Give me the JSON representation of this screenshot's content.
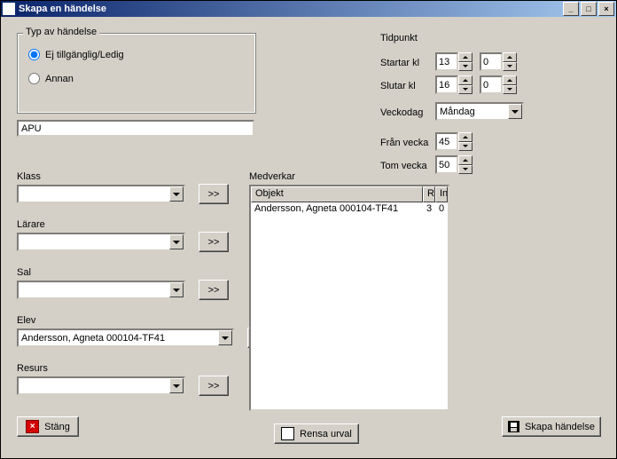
{
  "window": {
    "title": "Skapa en händelse"
  },
  "titlebar_buttons": {
    "min": "_",
    "max": "□",
    "close": "×"
  },
  "group_type": {
    "legend": "Typ av händelse",
    "opt_unavailable": "Ej tillgänglig/Ledig",
    "opt_other": "Annan"
  },
  "subject_value": "APU",
  "left": {
    "klass": {
      "label": "Klass",
      "value": ""
    },
    "larare": {
      "label": "Lärare",
      "value": ""
    },
    "sal": {
      "label": "Sal",
      "value": ""
    },
    "elev": {
      "label": "Elev",
      "value": "Andersson, Agneta 000104-TF41"
    },
    "resurs": {
      "label": "Resurs",
      "value": ""
    },
    "add_btn": ">>"
  },
  "time": {
    "heading": "Tidpunkt",
    "start_label": "Startar kl",
    "end_label": "Slutar kl",
    "weekday_label": "Veckodag",
    "from_week_label": "Från vecka",
    "to_week_label": "Tom vecka",
    "start_h": "13",
    "start_m": "0",
    "end_h": "16",
    "end_m": "0",
    "weekday": "Måndag",
    "from_week": "45",
    "to_week": "50"
  },
  "participants": {
    "heading": "Medverkar",
    "col_object": "Objekt",
    "col_r": "R",
    "col_in": "In",
    "rows": [
      {
        "object": "Andersson, Agneta 000104-TF41",
        "r": "3",
        "in": "0"
      }
    ]
  },
  "buttons": {
    "close": "Stäng",
    "clear": "Rensa urval",
    "create": "Skapa händelse"
  }
}
